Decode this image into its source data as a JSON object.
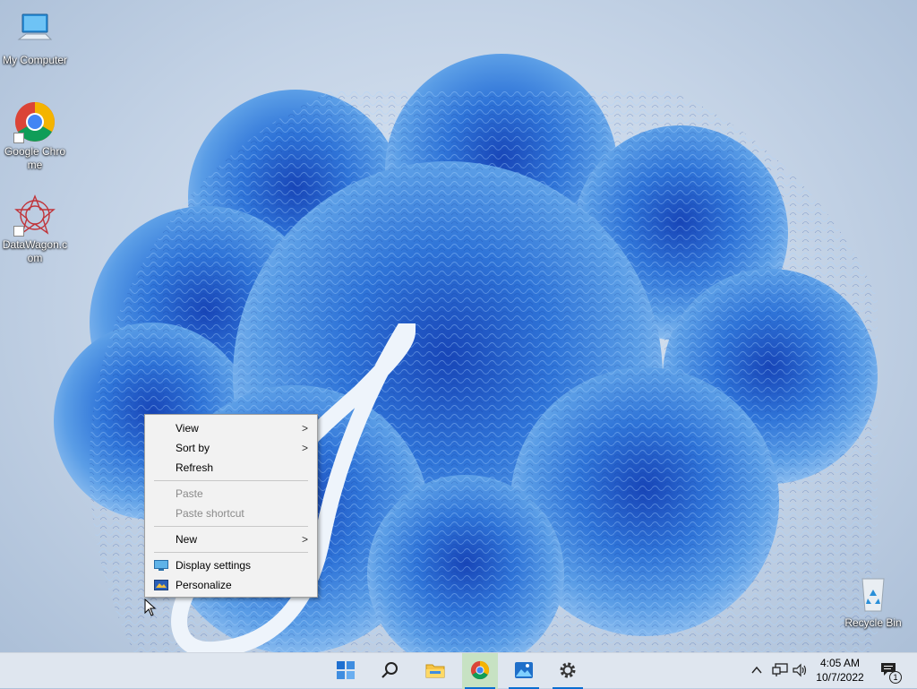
{
  "desktop": {
    "icons": [
      {
        "label": "My Computer",
        "icon": "computer-icon"
      },
      {
        "label": "Google Chrome",
        "icon": "chrome-icon"
      },
      {
        "label": "DataWagon.com",
        "icon": "datawagon-icon"
      },
      {
        "label": "Recycle Bin",
        "icon": "recycle-bin-icon"
      }
    ]
  },
  "context_menu": {
    "items": [
      {
        "label": "View",
        "submenu": true,
        "enabled": true
      },
      {
        "label": "Sort by",
        "submenu": true,
        "enabled": true
      },
      {
        "label": "Refresh",
        "enabled": true
      },
      {
        "label": "Paste",
        "enabled": false
      },
      {
        "label": "Paste shortcut",
        "enabled": false
      },
      {
        "label": "New",
        "submenu": true,
        "enabled": true
      },
      {
        "label": "Display settings",
        "icon": "display-icon",
        "enabled": true
      },
      {
        "label": "Personalize",
        "icon": "personalize-icon",
        "enabled": true
      }
    ],
    "arrow_glyph": ">"
  },
  "taskbar": {
    "buttons": [
      "start-icon",
      "search-icon",
      "file-explorer-icon",
      "chrome-icon",
      "photos-icon",
      "settings-icon"
    ],
    "accent": "#0a6ed1",
    "tray": {
      "time": "4:05 AM",
      "date": "10/7/2022",
      "notification_count": "1"
    }
  }
}
